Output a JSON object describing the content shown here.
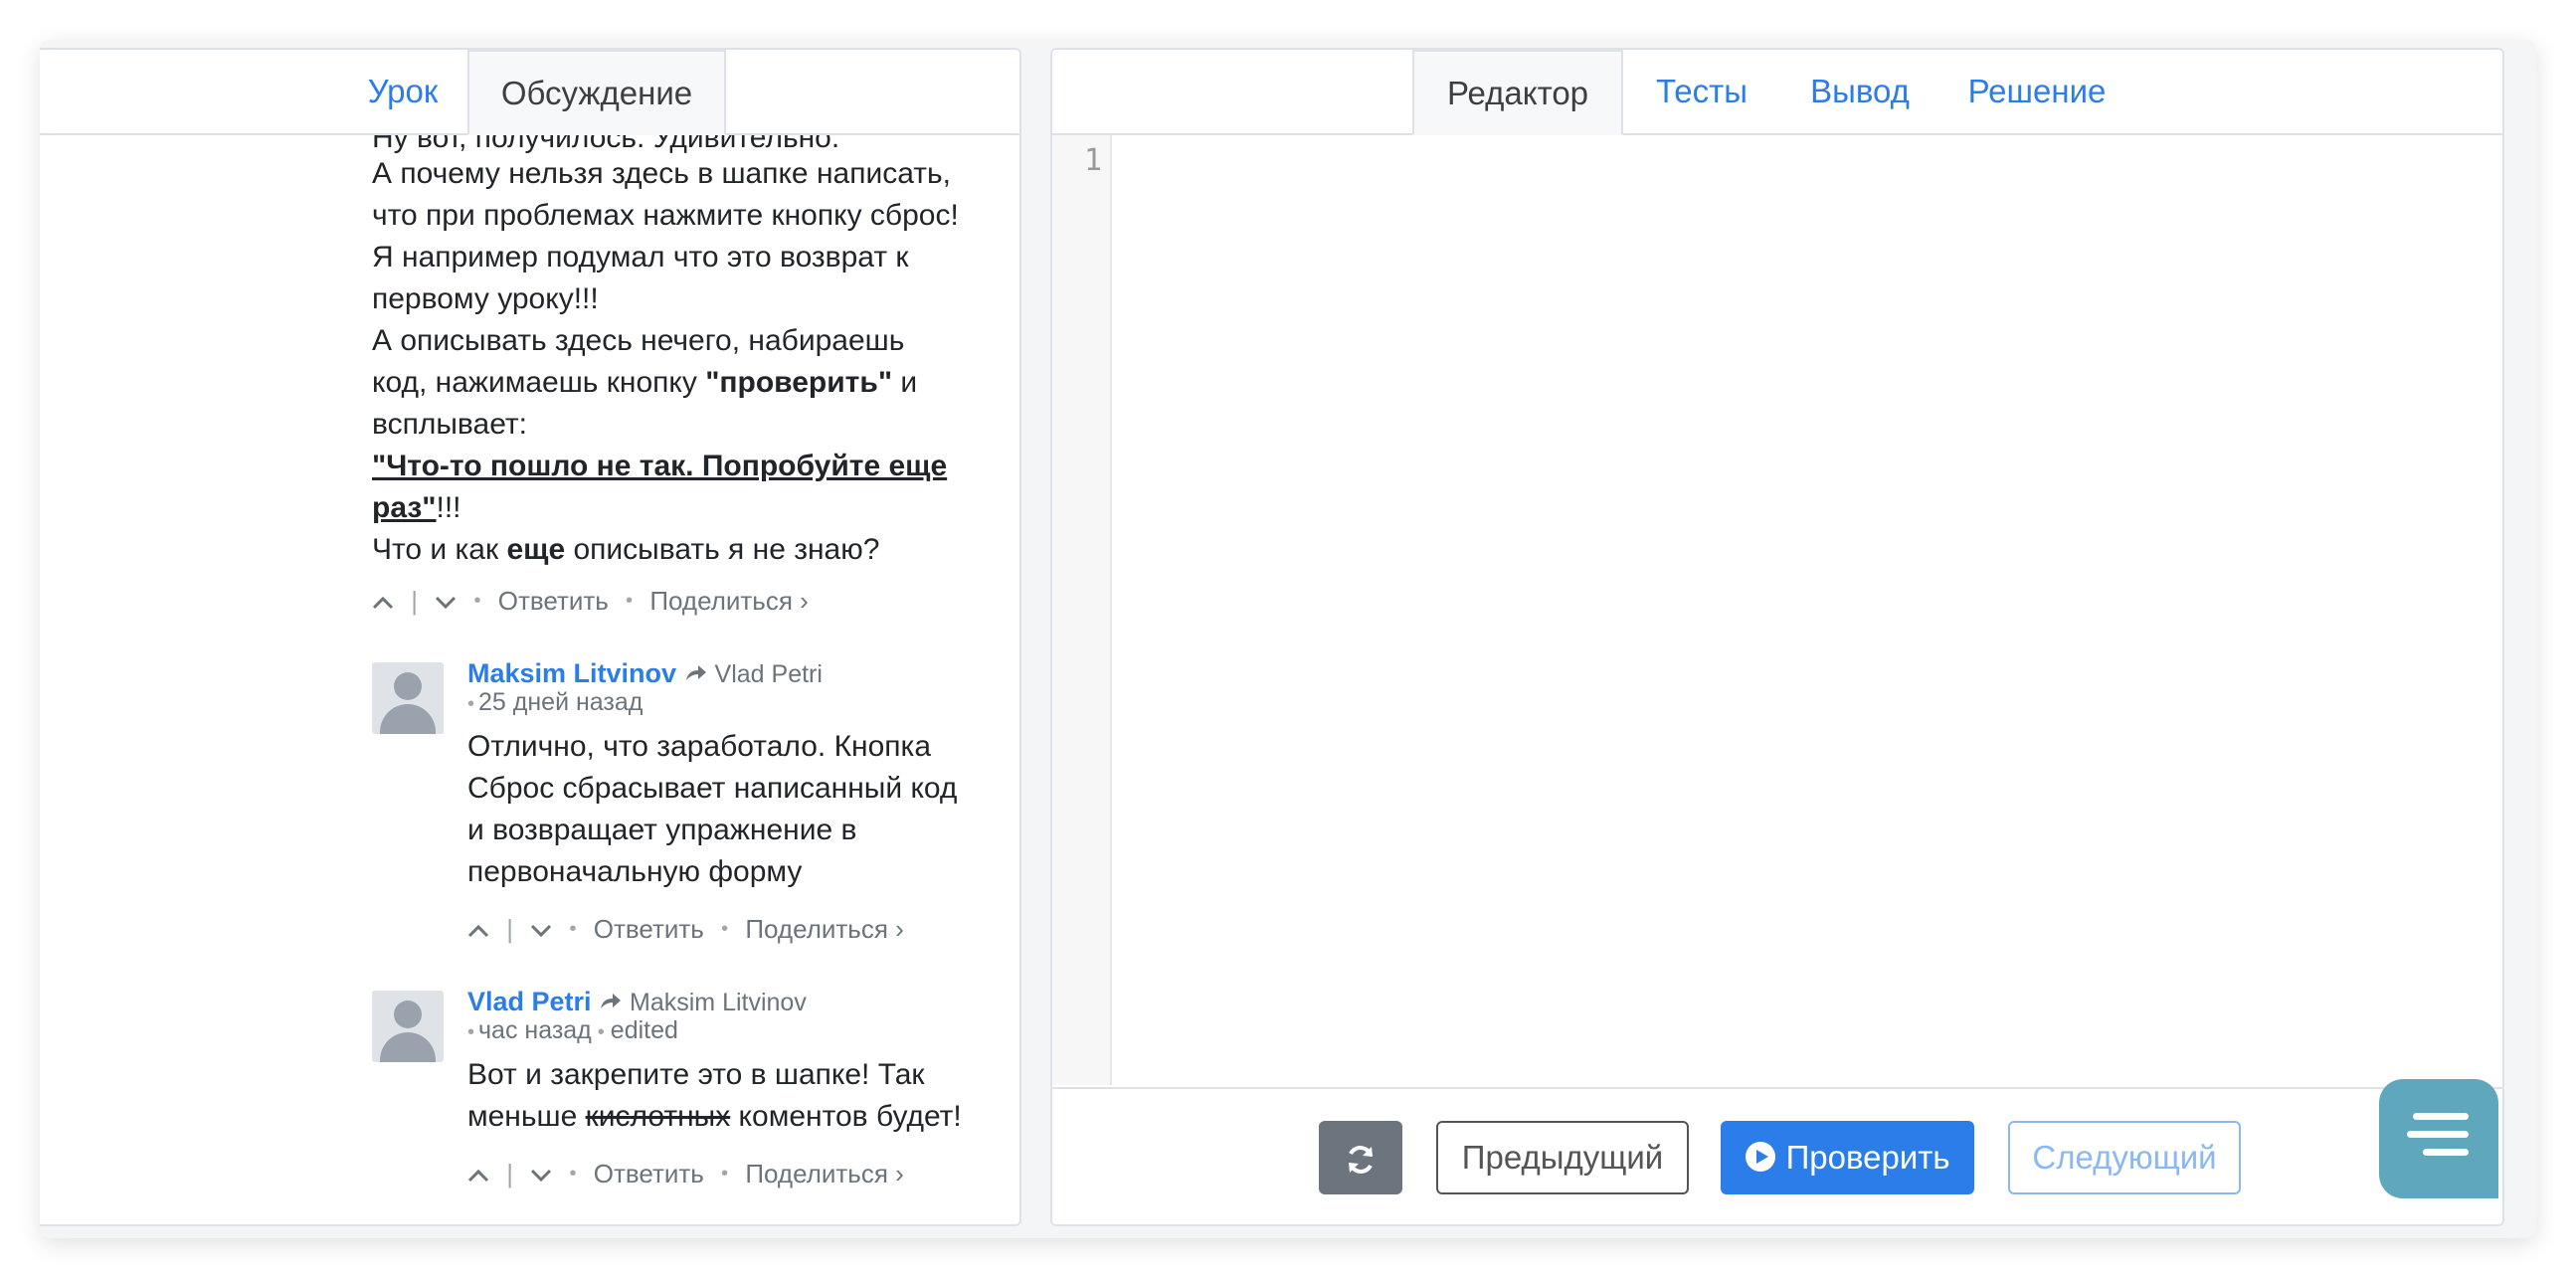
{
  "left_tabs": [
    "Урок",
    "Обсуждение"
  ],
  "right_tabs": [
    "Редактор",
    "Тесты",
    "Вывод",
    "Решение"
  ],
  "thread": {
    "top_comment": {
      "partial_line": "Ну вот, получилось. Удивительно.",
      "line1": "А почему нельзя здесь в шапке написать,",
      "line2": "что при проблемах нажмите кнопку сброс!",
      "line3": "Я например подумал что это возврат к",
      "line4": "первому уроку!!!",
      "line5": "А описывать здесь нечего, набираешь",
      "line6a": "код, нажимаешь кнопку ",
      "line6b": "\"проверить\"",
      "line6c": " и",
      "line7": "всплывает:",
      "line8": "\"Что-то пошло не так. Попробуйте еще",
      "line9a": "раз\"",
      "line9b": "!!!",
      "line10a": "Что и как ",
      "line10b": "еще",
      "line10c": " описывать я не знаю?"
    },
    "reply1": {
      "author": "Maksim Litvinov",
      "reply_to": "Vlad Petri",
      "time": "25 дней назад",
      "lines": [
        "Отлично, что заработало. Кнопка",
        "Сброс сбрасывает написанный код",
        "и возвращает упражнение в",
        "первоначальную форму"
      ]
    },
    "reply2": {
      "author": "Vlad Petri",
      "reply_to": "Maksim Litvinov",
      "time": "час назад",
      "edited": "edited",
      "line1": "Вот и закрепите это в шапке! Так",
      "line2a": "меньше ",
      "line2b": "кислотных",
      "line2c": " коментов будет!"
    },
    "actions": {
      "reply": "Ответить",
      "share": "Поделиться ›"
    }
  },
  "editor": {
    "line_number": "1"
  },
  "buttons": {
    "prev": "Предыдущий",
    "check": "Проверить",
    "next": "Следующий"
  }
}
